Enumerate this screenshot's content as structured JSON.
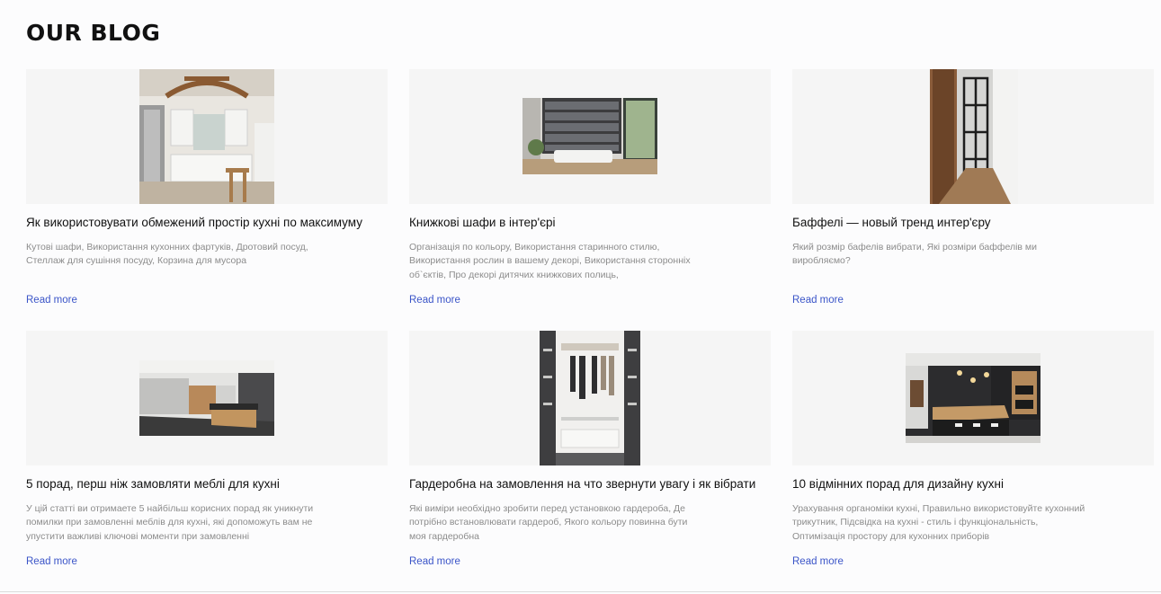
{
  "blog": {
    "title": "OUR BLOG",
    "posts": [
      {
        "title": "Як використовувати обмежений простір кухні по максимуму",
        "desc": "Кутові шафи, Використання кухонних фартуків, Дротовий посуд, Стеллаж для сушіння посуду, Корзина для мусора",
        "read_more": "Read more",
        "image": "white-kitchen-photo"
      },
      {
        "title": "Книжкові шафи в інтер'єрі",
        "desc": "Організація по кольору, Використання старинного стилю, Використання рослин в вашему декорі, Використання сторонніх об`єктів, Про декорі дитячих книжкових полиць,",
        "read_more": "Read more",
        "image": "bookshelf-living-room-photo"
      },
      {
        "title": "Баффелі — новый тренд интер'єру",
        "desc": "Який розмір бафелів вибрати, Які розміри баффелів ми виробляємо?",
        "read_more": "Read more",
        "image": "glass-partition-hallway-photo"
      },
      {
        "title": "5 порад, перш ніж замовляти меблі для кухні",
        "desc": "У цій статті ви отримаете 5 найбільш корисних порад як уникнути помилки при замовленні меблів для кухні, які допоможуть вам не упустити важливі ключові моменти при замовленні",
        "read_more": "Read more",
        "image": "wood-kitchen-island-photo"
      },
      {
        "title": "Гардеробна на замовлення на что звернути увагу і як вібрати",
        "desc": "Які виміри необхідно зробити перед установкою гардероба, Де потрібно встановлювати гардероб, Якого кольору повинна бути моя гардеробна",
        "read_more": "Read more",
        "image": "walk-in-closet-photo"
      },
      {
        "title": "10 відмінних порад для дизайну кухні",
        "desc": "Урахування органоміки кухні, Правильно використовуйте кухонний трикутник, Підсвідка на кухні - стиль і функціональність, Оптимізація простору для кухонних приборів",
        "read_more": "Read more",
        "image": "dark-kitchen-bar-photo"
      }
    ]
  },
  "colors": {
    "link": "#3b55c8",
    "card_bg": "#f5f5f5",
    "desc_text": "#8c8c8c"
  }
}
